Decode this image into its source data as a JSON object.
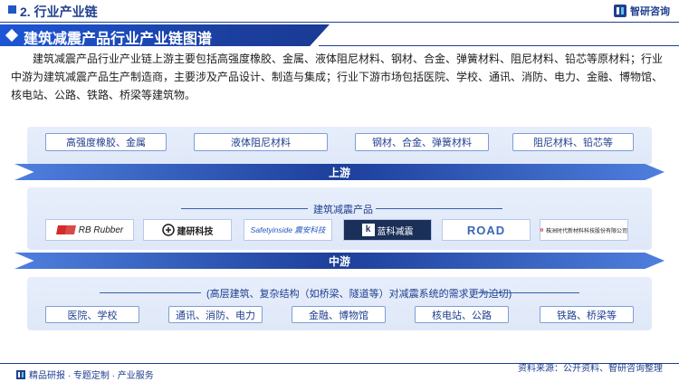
{
  "header": {
    "section_title": "2. 行业产业链",
    "brand_name": "智研咨询"
  },
  "banner": {
    "title": "建筑减震产品行业产业链图谱"
  },
  "intro": "建筑减震产品行业产业链上游主要包括高强度橡胶、金属、液体阻尼材料、钢材、合金、弹簧材料、阻尼材料、铅芯等原材料；行业中游为建筑减震产品生产制造商，主要涉及产品设计、制造与集成；行业下游市场包括医院、学校、通讯、消防、电力、金融、博物馆、核电站、公路、铁路、桥梁等建筑物。",
  "upstream": {
    "items": [
      "高强度橡胶、金属",
      "液体阻尼材料",
      "钢材、合金、弹簧材料",
      "阻尼材料、铅芯等"
    ],
    "arrow_label": "上游"
  },
  "midstream": {
    "title": "建筑减震产品",
    "logos": [
      {
        "text": "RB Rubber",
        "mark": "R",
        "color": "#d42a2a",
        "icon": "rb-rubber-logo"
      },
      {
        "text": "建研科技",
        "mark": "",
        "color": "#1d1d1d",
        "icon": "jianyan-logo"
      },
      {
        "text": "Safetyinside 震安科技",
        "mark": "",
        "color": "#1f57c3",
        "icon": "zhenan-logo"
      },
      {
        "text": "蓝科减震",
        "mark": "k",
        "color": "#ffffff",
        "icon": "lanke-logo"
      },
      {
        "text": "ROAD",
        "mark": "",
        "color": "#3866b8",
        "icon": "road-logo"
      },
      {
        "text": "株洲时代新材料科技股份有限公司",
        "mark": "",
        "color": "#c0392b",
        "icon": "times-new-material-logo"
      }
    ],
    "arrow_label": "中游"
  },
  "downstream": {
    "title": "(高层建筑、复杂结构（如桥梁、隧道等）对减震系统的需求更为迫切)",
    "items": [
      "医院、学校",
      "通讯、消防、电力",
      "金融、博物馆",
      "核电站、公路",
      "铁路、桥梁等"
    ]
  },
  "footer": {
    "left": "精品研报 · 专题定制 · 产业服务",
    "right": "资料来源：公开资料、智研咨询整理"
  },
  "colors": {
    "brand_blue": "#1f3f8f",
    "accent_blue": "#1f57c3",
    "band_bg": "#e2eaf9"
  }
}
